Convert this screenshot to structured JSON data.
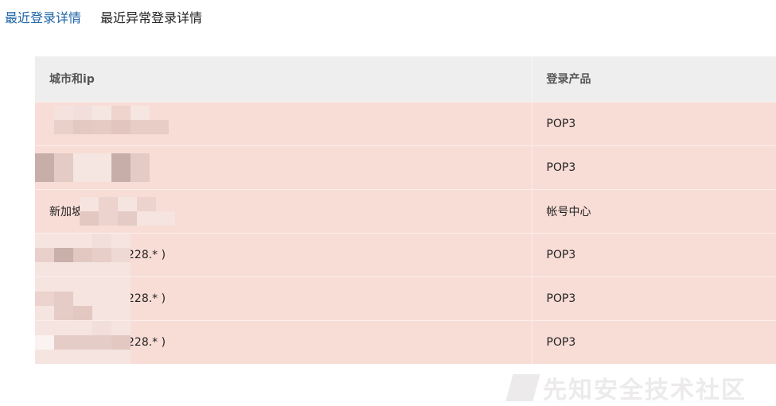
{
  "tabs": {
    "recent_login": "最近登录详情",
    "abnormal_login": "最近异常登录详情"
  },
  "table": {
    "headers": {
      "city_ip": "城市和ip",
      "product": "登录产品"
    },
    "rows": [
      {
        "city_ip": "",
        "product": "POP3"
      },
      {
        "city_ip": "",
        "product": "POP3"
      },
      {
        "city_ip": "新加坡",
        "product": "帐号中心"
      },
      {
        "city_ip": "228.* )",
        "product": "POP3"
      },
      {
        "city_ip": "228.* )",
        "product": "POP3"
      },
      {
        "city_ip": "228.* )",
        "product": "POP3"
      }
    ]
  },
  "watermark": "先知安全技术社区",
  "colors": {
    "active_tab": "#1e64a6",
    "header_bg": "#eeeeee",
    "row_bg": "#f8ddd6"
  }
}
